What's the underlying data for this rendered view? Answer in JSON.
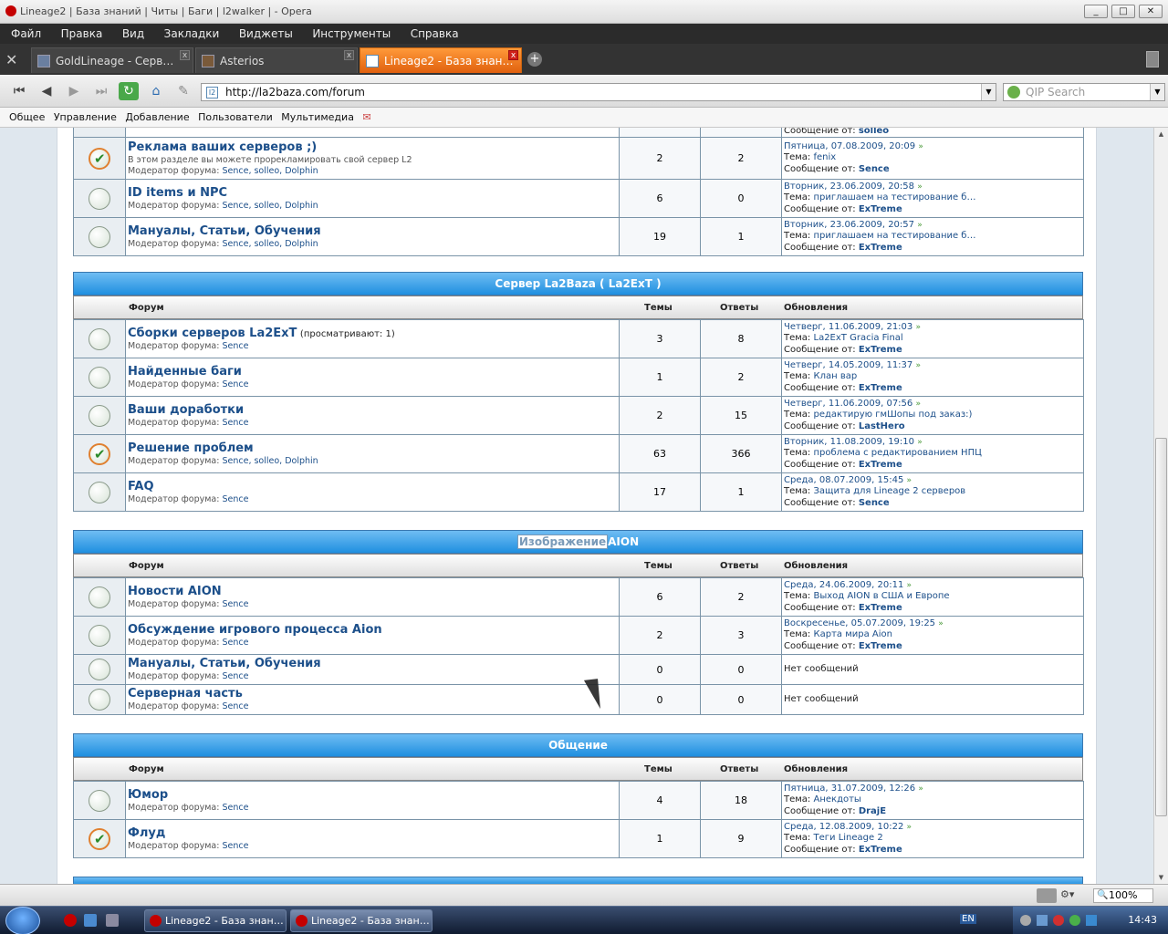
{
  "window": {
    "title": "Lineage2 | База знаний | Читы | Баги | l2walker | - Opera",
    "min": "_",
    "max": "□",
    "close": "✕"
  },
  "menu": [
    "Файл",
    "Правка",
    "Вид",
    "Закладки",
    "Виджеты",
    "Инструменты",
    "Справка"
  ],
  "tabs": [
    {
      "label": "GoldLineage - Серв…"
    },
    {
      "label": "Asterios"
    },
    {
      "label": "Lineage2 - База знан…"
    }
  ],
  "address": {
    "url": "http://la2baza.com/forum",
    "icon": "l2"
  },
  "search": {
    "placeholder": "QIP Search"
  },
  "bookmarks": [
    "Общее",
    "Управление",
    "Добавление",
    "Пользователи",
    "Мультимедиа"
  ],
  "columns": {
    "forum": "Форум",
    "topics": "Темы",
    "replies": "Ответы",
    "updates": "Обновления"
  },
  "labels": {
    "topic": "Тема:",
    "message_from": "Сообщение от:",
    "moderator": "Модератор форума:",
    "no_messages": "Нет сообщений"
  },
  "top_partial_row": {
    "from": "solleo"
  },
  "top_rows": [
    {
      "status": "new",
      "title": "Реклама ваших серверов ;)",
      "desc": "В этом разделе вы можете прорекламировать свой сервер L2",
      "mods": "Sence, solleo, Dolphin",
      "topics": "2",
      "replies": "2",
      "time": "Пятница, 07.08.2009, 20:09",
      "topic": "fenix",
      "from": "Sence"
    },
    {
      "status": "old",
      "title": "ID items и NPC",
      "desc": "",
      "mods": "Sence, solleo, Dolphin",
      "topics": "6",
      "replies": "0",
      "time": "Вторник, 23.06.2009, 20:58",
      "topic": "приглашаем на тестирование б…",
      "from": "ExTreme"
    },
    {
      "status": "old",
      "title": "Мануалы, Статьи, Обучения",
      "desc": "",
      "mods": "Sence, solleo, Dolphin",
      "topics": "19",
      "replies": "1",
      "time": "Вторник, 23.06.2009, 20:57",
      "topic": "приглашаем на тестирование б…",
      "from": "ExTreme"
    }
  ],
  "cat_la2": {
    "title": "Сервер La2Baza ( La2ExT )",
    "rows": [
      {
        "status": "old",
        "title": "Сборки серверов La2ExT",
        "viewing": "(просматривают: 1)",
        "mods": "Sence",
        "topics": "3",
        "replies": "8",
        "time": "Четверг, 11.06.2009, 21:03",
        "topic": "La2ExT Gracia Final",
        "from": "ExTreme"
      },
      {
        "status": "old",
        "title": "Найденные баги",
        "mods": "Sence",
        "topics": "1",
        "replies": "2",
        "time": "Четверг, 14.05.2009, 11:37",
        "topic": "Клан вар",
        "from": "ExTreme"
      },
      {
        "status": "old",
        "title": "Ваши доработки",
        "mods": "Sence",
        "topics": "2",
        "replies": "15",
        "time": "Четверг, 11.06.2009, 07:56",
        "topic": "редактирую гмШопы под заказ:)",
        "from": "LastHero"
      },
      {
        "status": "new",
        "title": "Решение проблем",
        "mods": "Sence, solleo, Dolphin",
        "topics": "63",
        "replies": "366",
        "time": "Вторник, 11.08.2009, 19:10",
        "topic": "проблема с редактированием НПЦ",
        "from": "ExTreme"
      },
      {
        "status": "old",
        "title": "FAQ",
        "mods": "Sence",
        "topics": "17",
        "replies": "1",
        "time": "Среда, 08.07.2009, 15:45",
        "topic": "Защита для Lineage 2 серверов",
        "from": "Sence"
      }
    ]
  },
  "cat_aion": {
    "title_sel": "Изображение",
    "title": "AION",
    "rows": [
      {
        "status": "old",
        "title": "Новости AION",
        "mods": "Sence",
        "topics": "6",
        "replies": "2",
        "time": "Среда, 24.06.2009, 20:11",
        "topic": "Выход AION в США и Европе",
        "from": "ExTreme"
      },
      {
        "status": "old",
        "title": "Обсуждение игрового процесса Aion",
        "mods": "Sence",
        "topics": "2",
        "replies": "3",
        "time": "Воскресенье, 05.07.2009, 19:25",
        "topic": "Карта мира Aion",
        "from": "ExTreme"
      },
      {
        "status": "old",
        "title": "Мануалы, Статьи, Обучения",
        "mods": "Sence",
        "topics": "0",
        "replies": "0"
      },
      {
        "status": "old",
        "title": "Серверная часть",
        "mods": "Sence",
        "topics": "0",
        "replies": "0"
      }
    ]
  },
  "cat_talk": {
    "title": "Общение",
    "rows": [
      {
        "status": "old",
        "title": "Юмор",
        "mods": "Sence",
        "topics": "4",
        "replies": "18",
        "time": "Пятница, 31.07.2009, 12:26",
        "topic": "Анекдоты",
        "from": "DrajE"
      },
      {
        "status": "new",
        "title": "Флуд",
        "mods": "Sence",
        "topics": "1",
        "replies": "9",
        "time": "Среда, 12.08.2009, 10:22",
        "topic": "Теги Lineage 2",
        "from": "ExTreme"
      }
    ]
  },
  "statusbar": {
    "zoom": "100%"
  },
  "taskbar": {
    "buttons": [
      "Lineage2 - База знан…",
      "Lineage2 - База знан…"
    ],
    "lang": "EN",
    "time": "14:43"
  }
}
